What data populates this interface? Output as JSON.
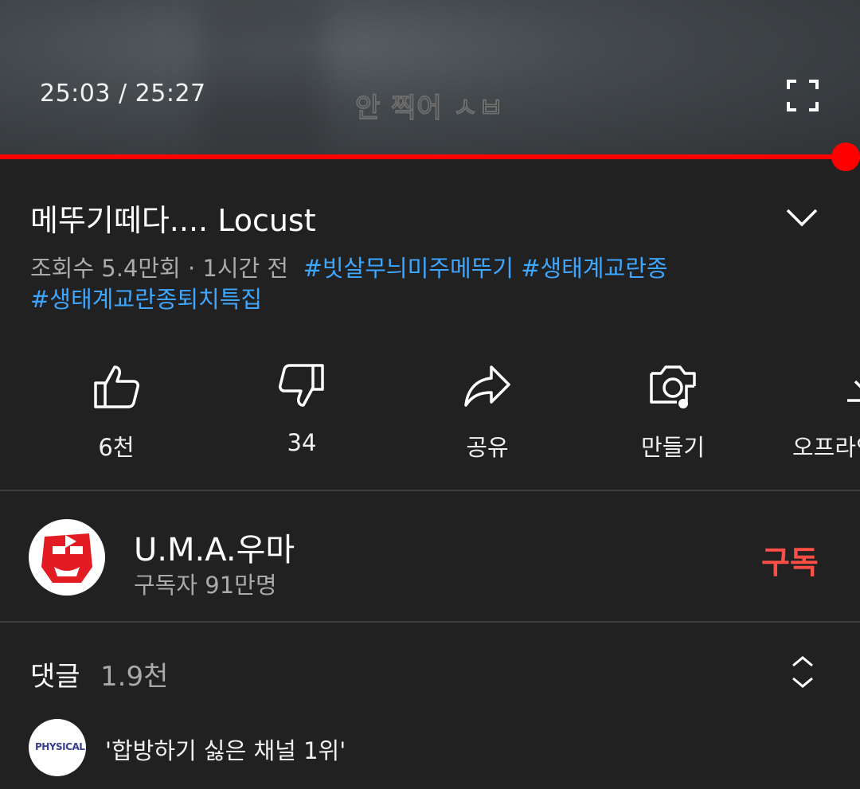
{
  "player": {
    "current_time": "25:03",
    "duration": "25:27",
    "time_separator": " / ",
    "subtitle": "안 찍어 ㅅㅂ",
    "progress_fraction": 0.983,
    "progress_color": "#ff0000",
    "fullscreen_icon": "fullscreen-icon"
  },
  "video": {
    "title": "메뚜기떼다.... Locust",
    "expand_icon": "chevron-down-icon",
    "views": "조회수 5.4만회",
    "age": "1시간 전",
    "hashtags": [
      "#빗살무늬미주메뚜기",
      "#생태계교란종",
      "#생태계교란종퇴치특집"
    ]
  },
  "actions": [
    {
      "icon": "thumbs-up-icon",
      "label": "6천"
    },
    {
      "icon": "thumbs-down-icon",
      "label": "34"
    },
    {
      "icon": "share-icon",
      "label": "공유"
    },
    {
      "icon": "create-icon",
      "label": "만들기"
    },
    {
      "icon": "download-icon",
      "label": "오프라인"
    }
  ],
  "channel": {
    "name": "U.M.A.우마",
    "subscribers": "구독자 91만명",
    "subscribe_label": "구독",
    "subscribe_color": "#ff4e45"
  },
  "comments": {
    "title": "댓글",
    "count": "1.9천",
    "expand_icon": "unfold-icon",
    "first": {
      "avatar_text": "PHYSICAL",
      "text": "'합방하기 싫은 채널 1위'"
    }
  },
  "colors": {
    "background": "#212121",
    "hashtag": "#3ea6ff",
    "secondary_text": "#aaaaaa"
  }
}
